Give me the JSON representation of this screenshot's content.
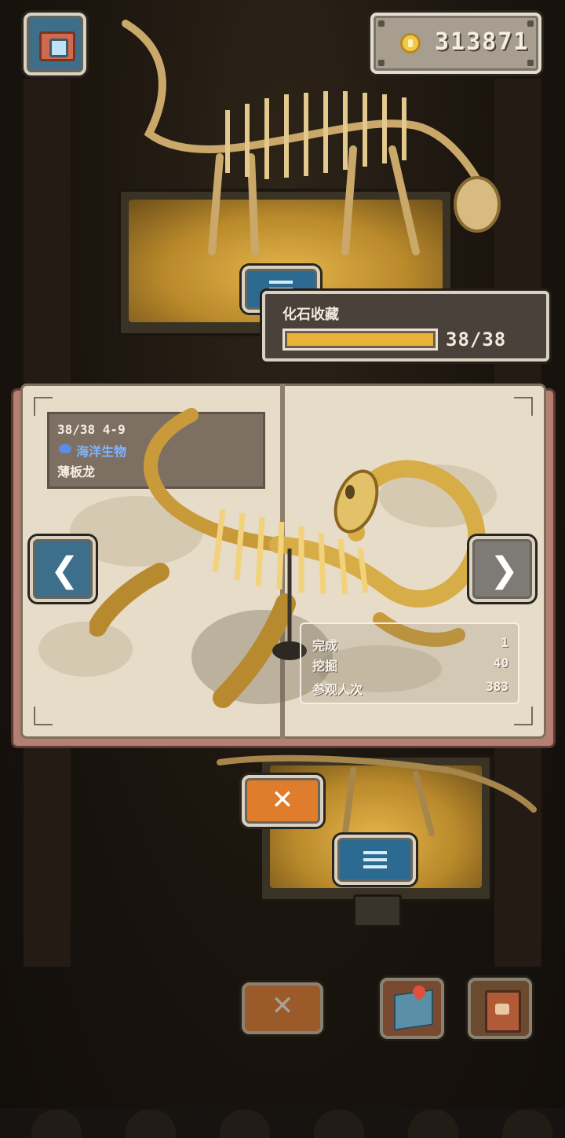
{
  "header": {
    "camera_icon": "camera-icon",
    "coins": "313871",
    "coin_icon": "gold-coin-icon"
  },
  "collection": {
    "title": "化石收藏",
    "count": "38/38",
    "progress": 1.0,
    "bar_color": "#e8b23a"
  },
  "book": {
    "index": "38/38 4-9",
    "category": "海洋生物",
    "category_color": "#7fb4ff",
    "name": "薄板龙",
    "stats": [
      {
        "label": "完成",
        "value": "1"
      },
      {
        "label": "挖掘",
        "value": "40"
      },
      {
        "label": "参观人次",
        "value": "383"
      }
    ],
    "prev_icon": "chevron-left-icon",
    "next_icon": "chevron-right-icon"
  },
  "controls": {
    "close_symbol": "✕",
    "bottom_close_symbol": "✕",
    "list_icon": "list-icon",
    "map_icon": "map-icon",
    "journal_icon": "journal-icon"
  },
  "colors": {
    "close_button": "#e07d2c",
    "list_button": "#2d6a92",
    "nav_active": "#3d6e8b",
    "nav_inactive": "#7e7a76"
  }
}
